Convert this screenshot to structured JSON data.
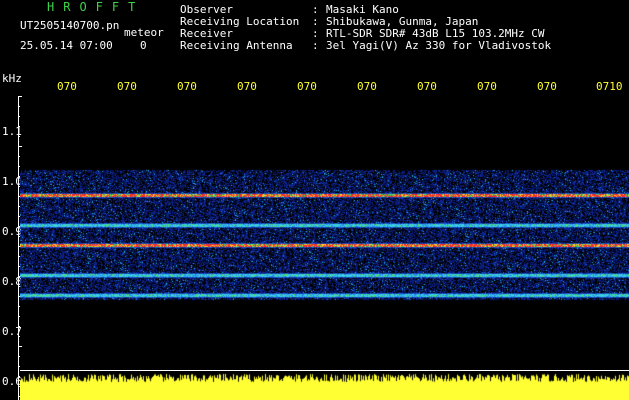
{
  "header": {
    "brand": "HROFFT",
    "filename": "UT2505140700.pn",
    "mode": "meteor",
    "datetime": "25.05.14 07:00",
    "count": "0",
    "fields": [
      {
        "label": "Observer",
        "value": "Masaki Kano"
      },
      {
        "label": "Receiving Location",
        "value": "Shibukawa, Gunma, Japan"
      },
      {
        "label": "Receiver",
        "value": "RTL-SDR SDR# 43dB L15 103.2MHz CW"
      },
      {
        "label": "Receiving Antenna",
        "value": "3el Yagi(V) Az 330 for Vladivostok"
      }
    ]
  },
  "axis": {
    "unit": "kHz",
    "x_ticks": [
      "070",
      "070",
      "070",
      "070",
      "070",
      "070",
      "070",
      "070",
      "070",
      "0710"
    ],
    "y_ticks": [
      "1.1",
      "1.0",
      "0.9",
      "0.8",
      "0.7",
      "0.6"
    ]
  },
  "colors": {
    "brand": "#3fd24a",
    "text": "#ffffff",
    "ticks": "#ffff33",
    "signal": "#ffff33",
    "spectrogram_low": "#0a1a8c",
    "spectrogram_high": "#ff2a2a"
  },
  "chart_data": {
    "type": "heatmap",
    "y_range_khz": [
      0.6,
      1.1
    ],
    "frequency_lines_khz": [
      0.97,
      0.91,
      0.87,
      0.81,
      0.77
    ],
    "strong_lines_khz": [
      0.97,
      0.87
    ],
    "band_khz": [
      0.76,
      1.02
    ]
  }
}
